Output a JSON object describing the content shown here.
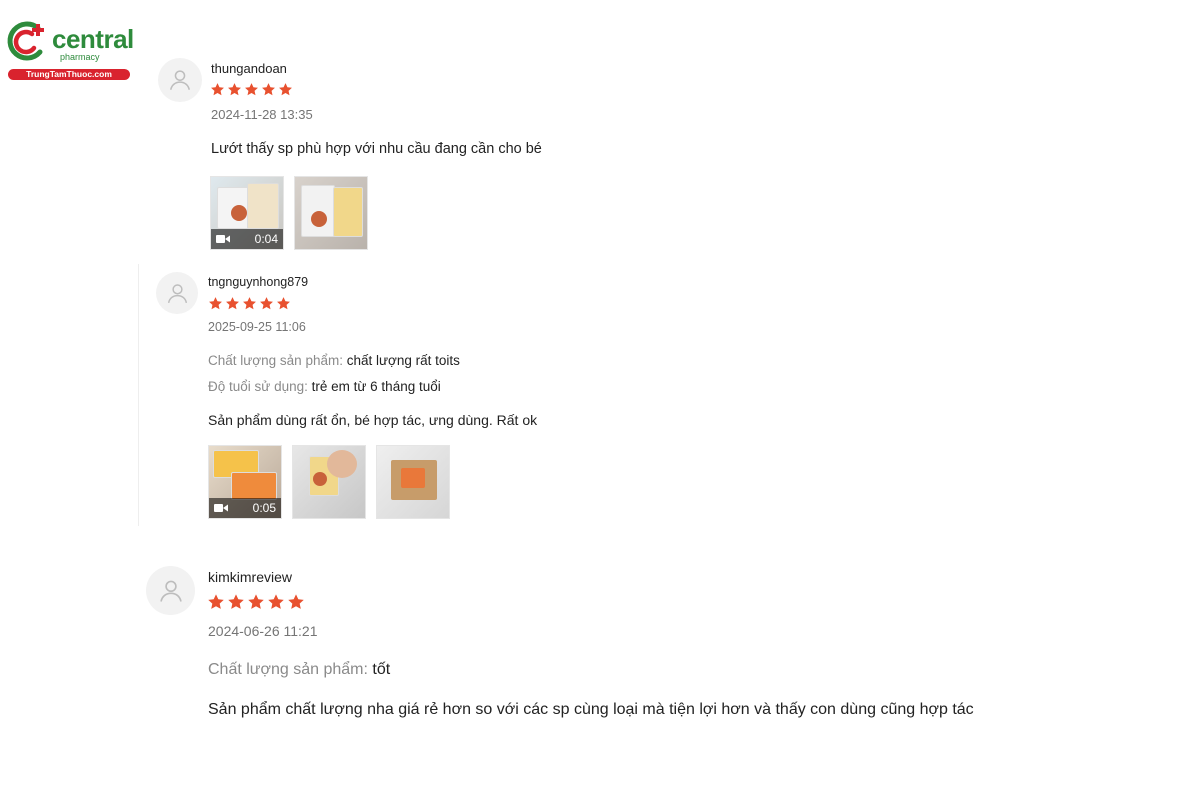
{
  "brand": {
    "name": "central",
    "tagline": "pharmacy",
    "url": "TrungTamThuoc.com",
    "colors": {
      "green": "#2e8b3c",
      "red": "#d9232e"
    }
  },
  "colors": {
    "star": "#e8512f",
    "muted": "#757575",
    "label": "#8a8a8a"
  },
  "reviews": [
    {
      "username": "thungandoan",
      "rating": 5,
      "datetime": "2024-11-28 13:35",
      "attributes": [],
      "comment": "Lướt thấy sp phù hợp với nhu cầu đang cần cho bé",
      "media": [
        {
          "type": "video",
          "duration": "0:04",
          "icon": "video-camera-icon"
        },
        {
          "type": "image"
        }
      ]
    },
    {
      "username": "tngnguynhong879",
      "rating": 5,
      "datetime": "2025-09-25 11:06",
      "attributes": [
        {
          "label": "Chất lượng sản phẩm:",
          "value": "chất lượng rất toits"
        },
        {
          "label": "Độ tuổi sử dụng:",
          "value": "trẻ em từ 6 tháng tuổi"
        }
      ],
      "comment": "Sản phẩm dùng rất ổn, bé hợp tác, ưng dùng. Rất ok",
      "media": [
        {
          "type": "video",
          "duration": "0:05",
          "icon": "video-camera-icon"
        },
        {
          "type": "image"
        },
        {
          "type": "image"
        }
      ]
    },
    {
      "username": "kimkimreview",
      "rating": 5,
      "datetime": "2024-06-26 11:21",
      "attributes": [
        {
          "label": "Chất lượng sản phẩm:",
          "value": "tốt"
        }
      ],
      "comment": "Sản phẩm chất lượng nha giá rẻ hơn so với các sp cùng loại mà tiện lợi hơn và thấy con dùng cũng hợp tác",
      "media": []
    }
  ]
}
